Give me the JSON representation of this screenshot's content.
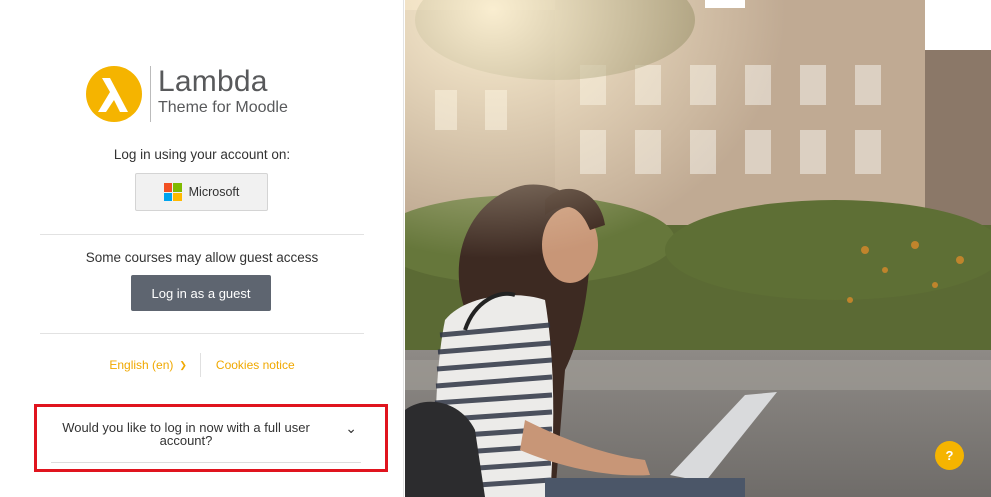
{
  "brand": {
    "name": "Lambda",
    "tagline": "Theme for Moodle",
    "accent_color": "#f5b400"
  },
  "login": {
    "prompt": "Log in using your account on:",
    "microsoft_button": "Microsoft",
    "microsoft_icon": "microsoft-logo-icon"
  },
  "guest": {
    "prompt": "Some courses may allow guest access",
    "button": "Log in as a guest"
  },
  "footer": {
    "language": "English (en)",
    "language_icon": "chevron-down-icon",
    "cookies": "Cookies notice"
  },
  "full_account": {
    "question": "Would you like to log in now with a full user account?",
    "highlight_color": "#e0141e"
  },
  "help": {
    "label": "?"
  }
}
